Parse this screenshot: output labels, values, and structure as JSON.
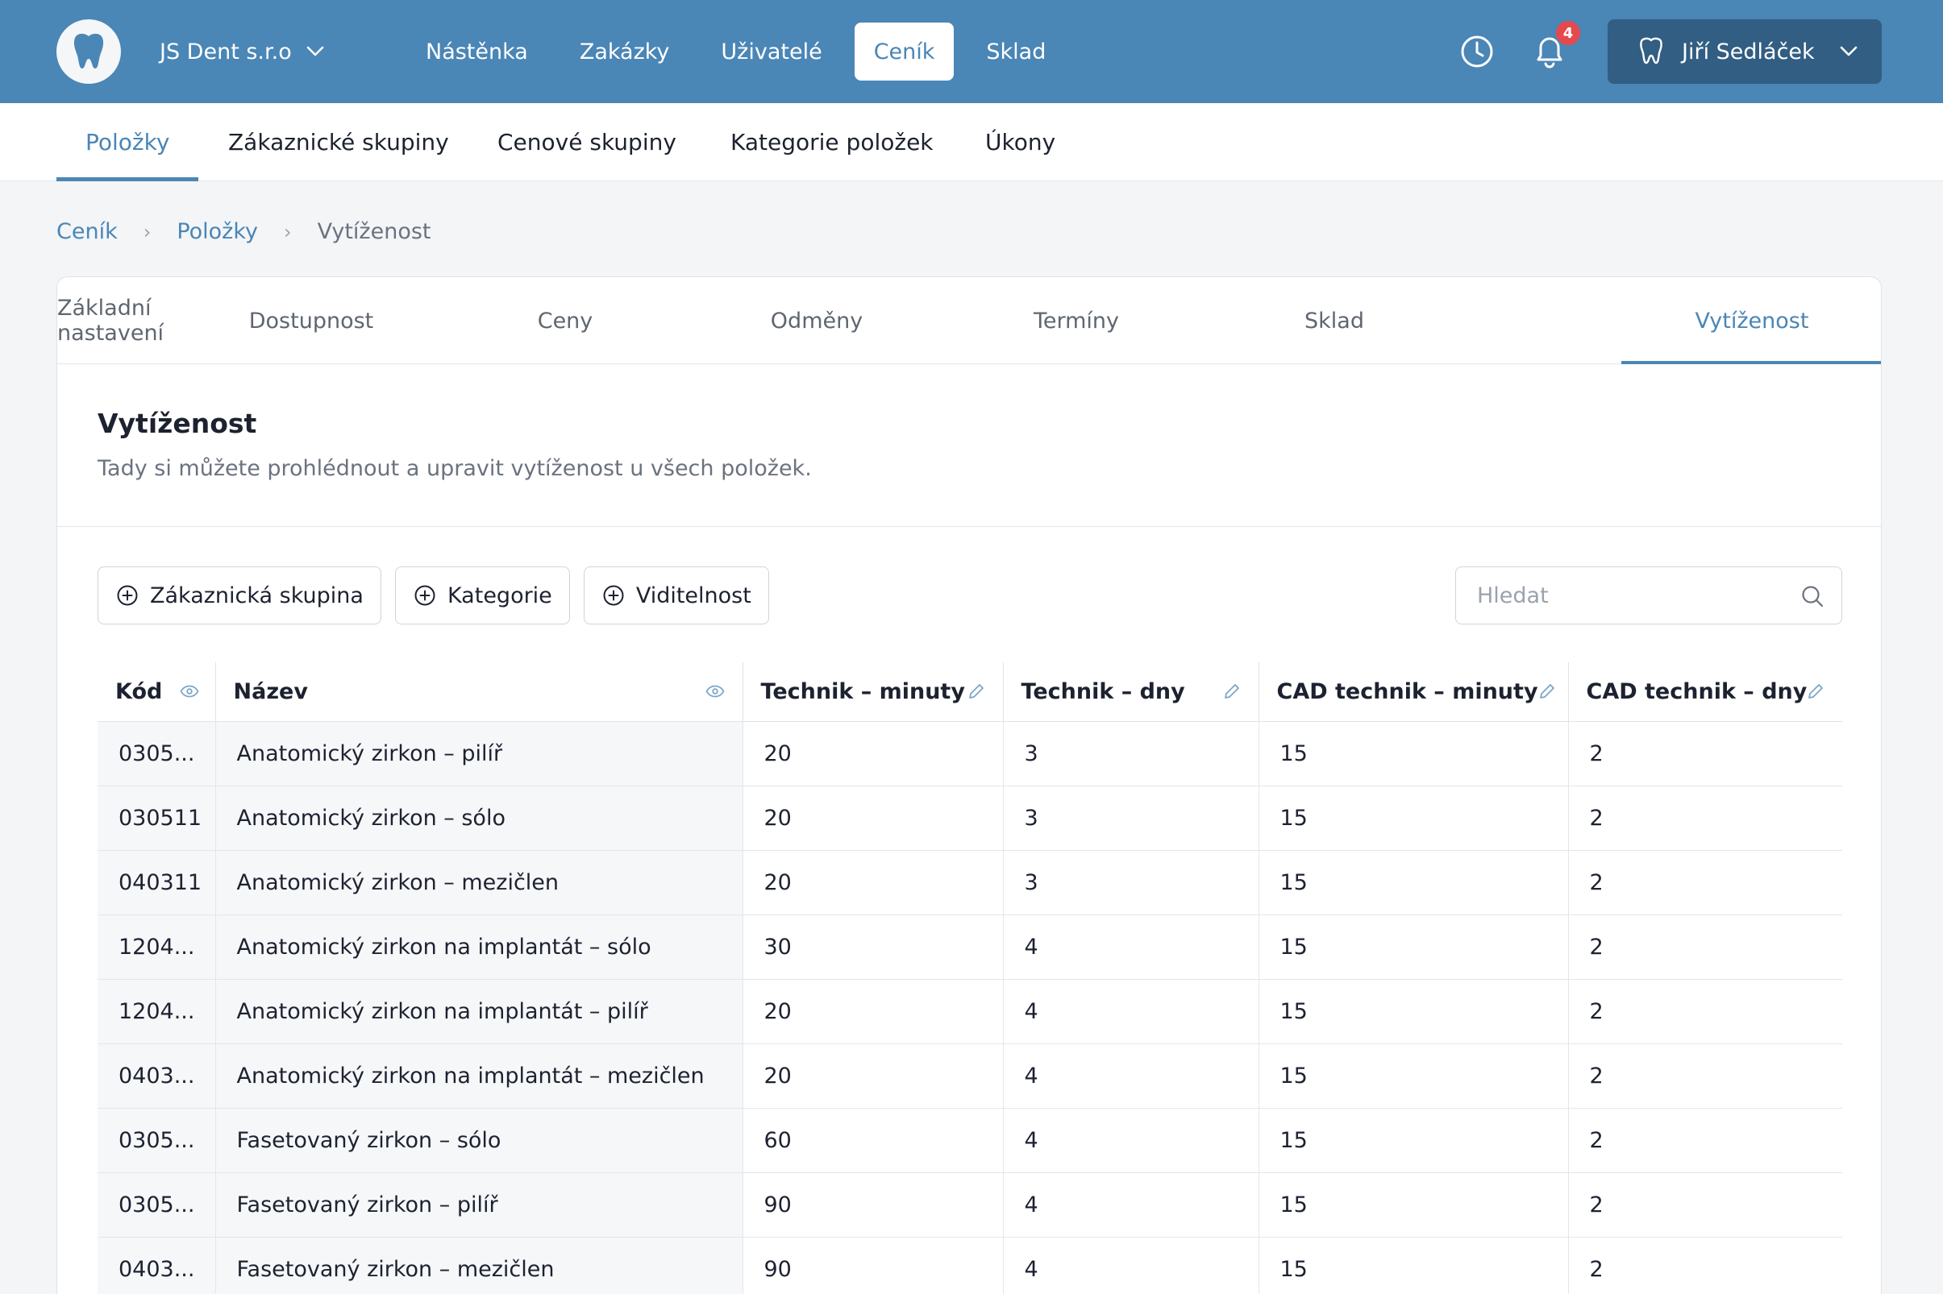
{
  "topbar": {
    "company": "JS Dent s.r.o",
    "nav": [
      "Nástěnka",
      "Zakázky",
      "Uživatelé",
      "Ceník",
      "Sklad"
    ],
    "active_nav": "Ceník",
    "notifications_count": "4",
    "user_name": "Jiří Sedláček",
    "icons": [
      "tooth-logo-icon",
      "chevron-down-icon",
      "clock-icon",
      "bell-icon",
      "tooth-icon"
    ],
    "brand_color": "#4a86b6"
  },
  "subnav": {
    "tabs": [
      "Položky",
      "Zákaznické skupiny",
      "Cenové skupiny",
      "Kategorie položek",
      "Úkony"
    ],
    "active": "Položky"
  },
  "breadcrumb": {
    "items": [
      "Ceník",
      "Položky",
      "Vytíženost"
    ]
  },
  "inner_tabs": {
    "tabs": [
      "Základní nastavení",
      "Dostupnost",
      "Ceny",
      "Odměny",
      "Termíny",
      "Sklad",
      "Vytíženost"
    ],
    "active": "Vytíženost"
  },
  "section": {
    "title": "Vytíženost",
    "description": "Tady si můžete prohlédnout a upravit vytíženost u všech položek."
  },
  "filters": {
    "buttons": [
      "Zákaznická skupina",
      "Kategorie",
      "Viditelnost"
    ]
  },
  "search": {
    "placeholder": "Hledat"
  },
  "table": {
    "headers": [
      "Kód",
      "Název",
      "Technik – minuty",
      "Technik – dny",
      "CAD technik – minuty",
      "CAD technik – dny"
    ],
    "rows": [
      [
        "0305...",
        "Anatomický zirkon – pilíř",
        "20",
        "3",
        "15",
        "2"
      ],
      [
        "030511",
        "Anatomický zirkon – sólo",
        "20",
        "3",
        "15",
        "2"
      ],
      [
        "040311",
        "Anatomický zirkon – mezičlen",
        "20",
        "3",
        "15",
        "2"
      ],
      [
        "1204...",
        "Anatomický zirkon na implantát – sólo",
        "30",
        "4",
        "15",
        "2"
      ],
      [
        "1204...",
        "Anatomický zirkon na implantát – pilíř",
        "20",
        "4",
        "15",
        "2"
      ],
      [
        "0403...",
        "Anatomický zirkon na implantát – mezičlen",
        "20",
        "4",
        "15",
        "2"
      ],
      [
        "0305...",
        "Fasetovaný zirkon – sólo",
        "60",
        "4",
        "15",
        "2"
      ],
      [
        "0305...",
        "Fasetovaný zirkon – pilíř",
        "90",
        "4",
        "15",
        "2"
      ],
      [
        "0403...",
        "Fasetovaný zirkon – mezičlen",
        "90",
        "4",
        "15",
        "2"
      ]
    ]
  }
}
